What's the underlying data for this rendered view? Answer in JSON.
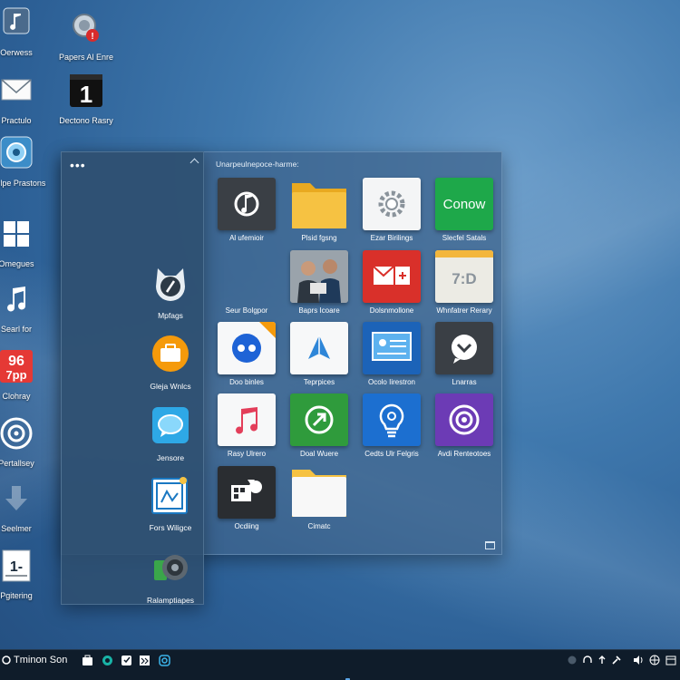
{
  "desktop": {
    "icons": [
      {
        "label": "Oerwess",
        "icon": "music-note-badge-icon"
      },
      {
        "label": "Papers Al Enre",
        "icon": "gear-badge-icon"
      },
      {
        "label": "Practulo",
        "icon": "mail-icon"
      },
      {
        "label": "Dectono Rasry",
        "icon": "calendar-one-icon"
      },
      {
        "label": "Vilelpe Prastons",
        "icon": "camera-lens-icon"
      },
      {
        "label": "Omegues",
        "icon": "windows-grid-icon"
      },
      {
        "label": "Searl for",
        "icon": "music-note-icon"
      },
      {
        "label": "Clohray",
        "icon": "calendar-96-icon",
        "badge_text": "96\n7pp"
      },
      {
        "label": "Pertallsey",
        "icon": "target-icon"
      },
      {
        "label": "Seelmer",
        "icon": "download-arrow-icon"
      },
      {
        "label": "Pgitering",
        "icon": "document-calendar-icon"
      }
    ]
  },
  "panel": {
    "heading": "Unarpeulnepoce-harme:",
    "left_apps": [
      {
        "label": "Mpfags",
        "icon": "cat-compass-icon"
      },
      {
        "label": "Gleja Wnlcs",
        "icon": "briefcase-icon"
      },
      {
        "label": "Jensore",
        "icon": "chat-bubble-icon"
      },
      {
        "label": "Fors Wiligce",
        "icon": "photo-editor-icon"
      },
      {
        "label": "Ralamptiapes",
        "icon": "camera-recorder-icon"
      }
    ],
    "tiles": [
      {
        "label": "Al ufemioir",
        "icon": "music-player-icon"
      },
      {
        "label": "Plsid fgsng",
        "icon": "folder-icon"
      },
      {
        "label": "Ezar Birilings",
        "icon": "settings-gear-icon"
      },
      {
        "label": "Slecfel Satals",
        "icon": "conow-tile-icon",
        "text": "Conow"
      },
      {
        "label": "Seur Bolgpor",
        "icon": "blank-tile-icon"
      },
      {
        "label": "Baprs Icoare",
        "icon": "people-photo-icon"
      },
      {
        "label": "Dolsnmollone",
        "icon": "mail-plus-icon"
      },
      {
        "label": "Whnfatrer Rerary",
        "icon": "7d-calendar-icon",
        "text": "7:D"
      },
      {
        "label": "Doo binles",
        "icon": "flickr-dots-icon"
      },
      {
        "label": "Teprpices",
        "icon": "paper-plane-icon"
      },
      {
        "label": "Ocolo Iirestron",
        "icon": "presentation-icon"
      },
      {
        "label": "Lnarras",
        "icon": "chevron-chat-icon"
      },
      {
        "label": "Rasy Ulrero",
        "icon": "music-app-icon"
      },
      {
        "label": "Doal Wuere",
        "icon": "arrow-circle-icon"
      },
      {
        "label": "Cedts Ulr Felgris",
        "icon": "lightbulb-icon"
      },
      {
        "label": "Avdi Renteotoes",
        "icon": "target-camera-icon"
      },
      {
        "label": "Ocdiing",
        "icon": "film-editor-icon"
      },
      {
        "label": "Cimatc",
        "icon": "folder-white-icon"
      }
    ]
  },
  "taskbar": {
    "title": "Tminon Son",
    "pinned": [
      "briefcase-icon",
      "circle-icon",
      "archive-icon",
      "bookmark-icon",
      "instagram-icon"
    ],
    "tray": [
      "circle-icon",
      "headphones-icon",
      "up-arrow-icon",
      "tools-icon",
      "speaker-icon",
      "grid-icon"
    ]
  },
  "colors": {
    "accent": "#0a7bd0",
    "taskbar_bg": "#0f1c2a",
    "folder_yellow": "#f6c242",
    "conow_green": "#1ea84a",
    "mail_red": "#d9302a"
  }
}
